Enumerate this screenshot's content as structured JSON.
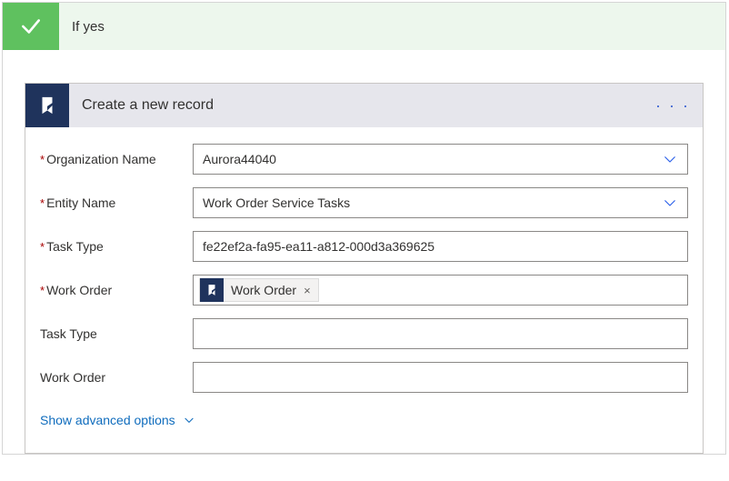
{
  "condition": {
    "title": "If yes"
  },
  "card": {
    "title": "Create a new record",
    "fields": [
      {
        "label": "Organization Name",
        "required": true,
        "type": "dropdown",
        "value": "Aurora44040"
      },
      {
        "label": "Entity Name",
        "required": true,
        "type": "dropdown",
        "value": "Work Order Service Tasks"
      },
      {
        "label": "Task Type",
        "required": true,
        "type": "text",
        "value": "fe22ef2a-fa95-ea11-a812-000d3a369625"
      },
      {
        "label": "Work Order",
        "required": true,
        "type": "token",
        "token_label": "Work Order"
      },
      {
        "label": "Task Type",
        "required": false,
        "type": "text",
        "value": ""
      },
      {
        "label": "Work Order",
        "required": false,
        "type": "text",
        "value": ""
      }
    ],
    "advanced_label": "Show advanced options"
  },
  "glyphs": {
    "ellipsis": "· · ·",
    "token_remove": "×",
    "req": "*"
  }
}
